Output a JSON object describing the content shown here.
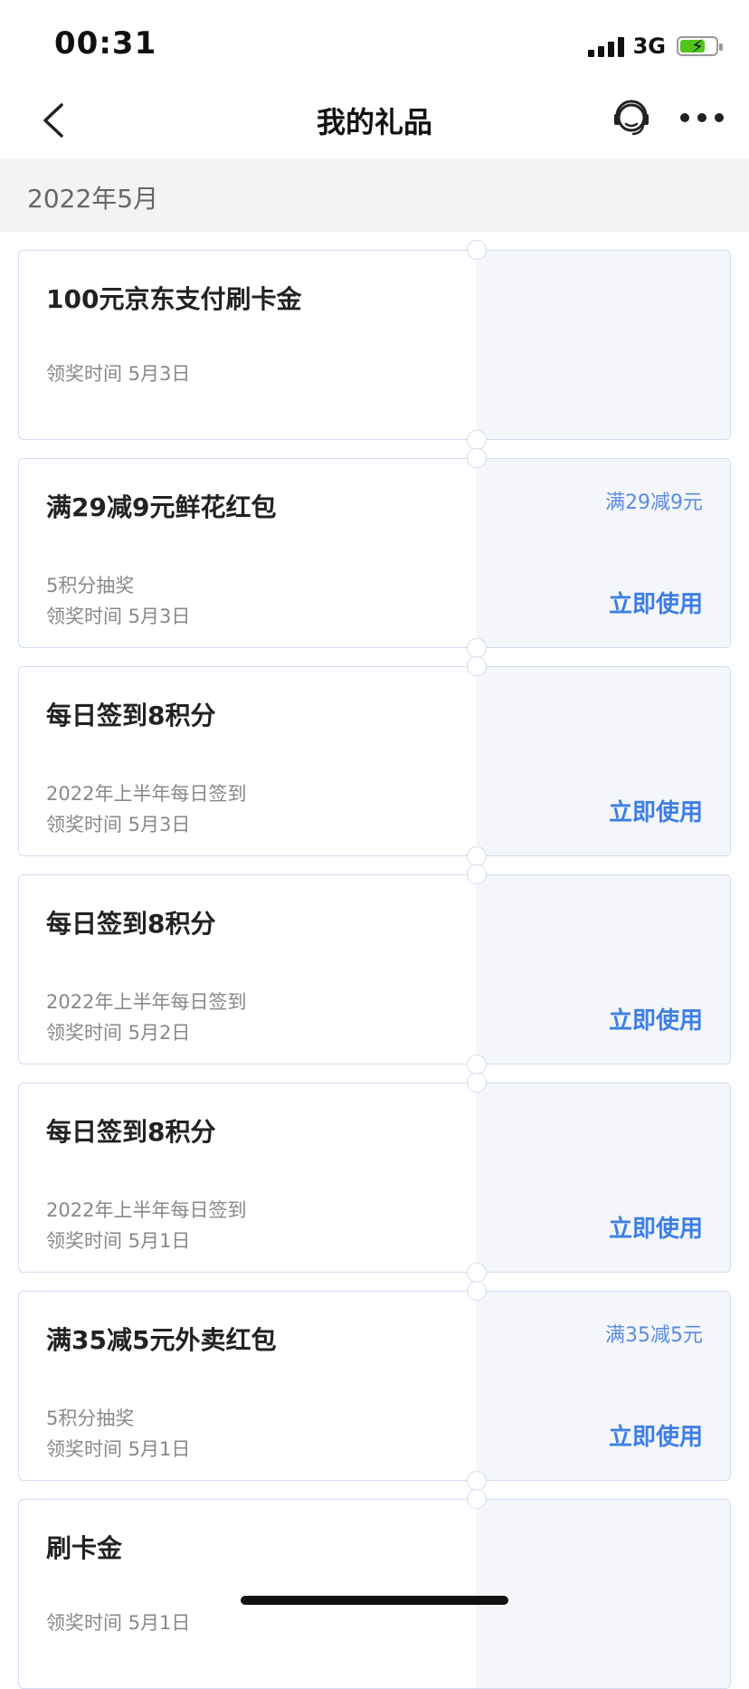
{
  "status_bar": {
    "time": "00:31",
    "network": "3G",
    "battery_level": 0.7
  },
  "nav": {
    "title": "我的礼品"
  },
  "month_header": "2022年5月",
  "rewards": [
    {
      "title": "100元京东支付刷卡金",
      "subtitle": "",
      "time": "领奖时间 5月3日",
      "badge": "",
      "action": ""
    },
    {
      "title": "满29减9元鲜花红包",
      "subtitle": "5积分抽奖",
      "time": "领奖时间 5月3日",
      "badge": "满29减9元",
      "action": "立即使用"
    },
    {
      "title": "每日签到8积分",
      "subtitle": "2022年上半年每日签到",
      "time": "领奖时间 5月3日",
      "badge": "",
      "action": "立即使用"
    },
    {
      "title": "每日签到8积分",
      "subtitle": "2022年上半年每日签到",
      "time": "领奖时间 5月2日",
      "badge": "",
      "action": "立即使用"
    },
    {
      "title": "每日签到8积分",
      "subtitle": "2022年上半年每日签到",
      "time": "领奖时间 5月1日",
      "badge": "",
      "action": "立即使用"
    },
    {
      "title": "满35减5元外卖红包",
      "subtitle": "5积分抽奖",
      "time": "领奖时间 5月1日",
      "badge": "满35减5元",
      "action": "立即使用"
    },
    {
      "title": "刷卡金",
      "subtitle": "",
      "time": "领奖时间 5月1日",
      "badge": "",
      "action": ""
    }
  ]
}
